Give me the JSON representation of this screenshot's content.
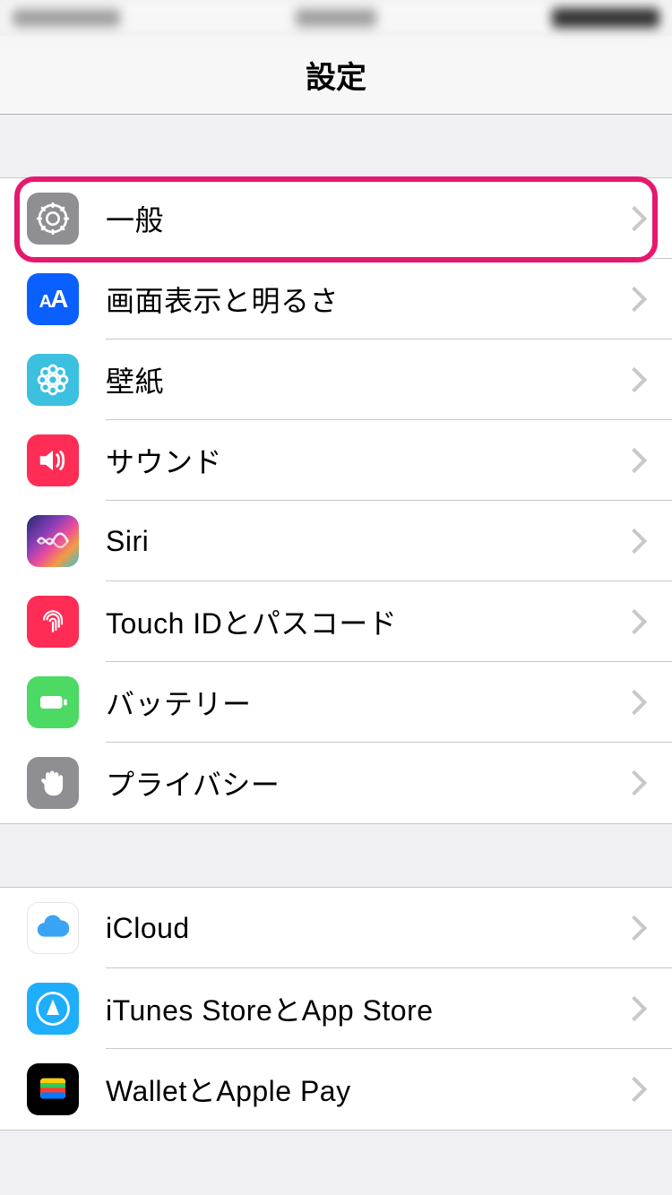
{
  "header": {
    "title": "設定"
  },
  "group1": {
    "items": [
      {
        "label": "一般",
        "icon": "gear",
        "highlighted": true
      },
      {
        "label": "画面表示と明るさ",
        "icon": "display"
      },
      {
        "label": "壁紙",
        "icon": "wallpaper"
      },
      {
        "label": "サウンド",
        "icon": "sound"
      },
      {
        "label": "Siri",
        "icon": "siri"
      },
      {
        "label": "Touch IDとパスコード",
        "icon": "touchid"
      },
      {
        "label": "バッテリー",
        "icon": "battery"
      },
      {
        "label": "プライバシー",
        "icon": "privacy"
      }
    ]
  },
  "group2": {
    "items": [
      {
        "label": "iCloud",
        "icon": "icloud"
      },
      {
        "label": "iTunes StoreとApp Store",
        "icon": "itunes"
      },
      {
        "label": "WalletとApple Pay",
        "icon": "wallet"
      }
    ]
  }
}
